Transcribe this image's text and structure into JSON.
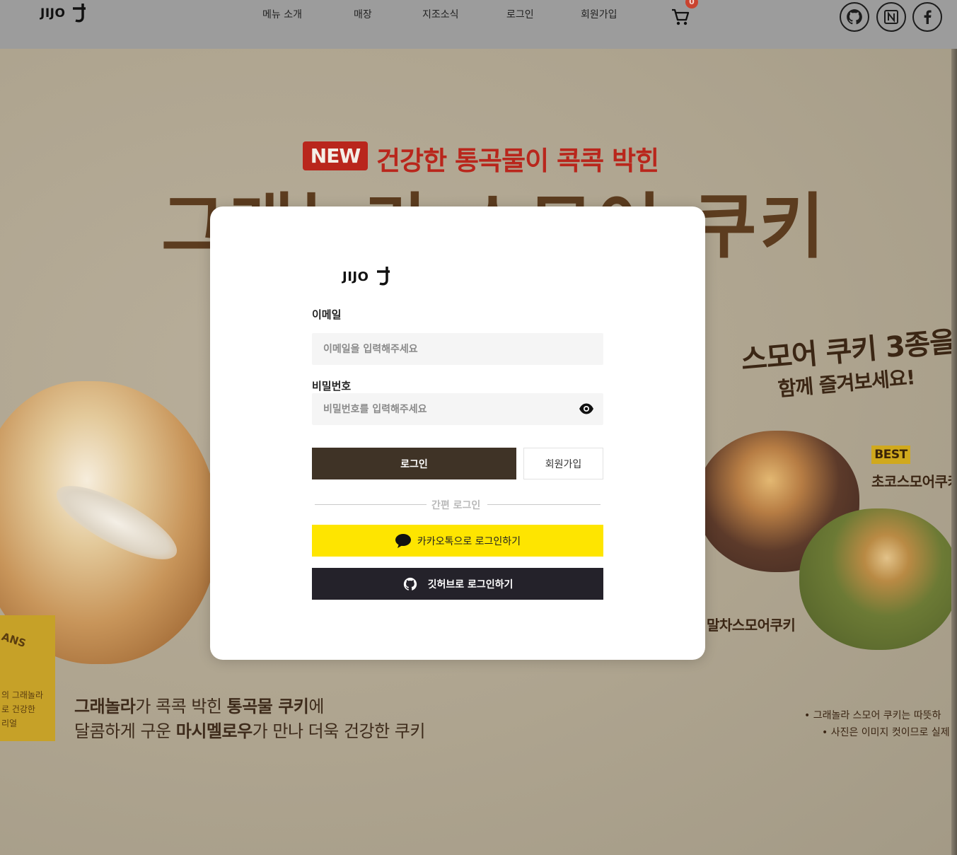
{
  "header": {
    "brand": "JIJO",
    "nav": [
      {
        "label": "메뉴 소개"
      },
      {
        "label": "매장"
      },
      {
        "label": "지조소식"
      },
      {
        "label": "로그인"
      },
      {
        "label": "회원가입"
      }
    ],
    "cart_count": "0",
    "social_icons": [
      "github-icon",
      "notion-icon",
      "facebook-icon"
    ]
  },
  "banner": {
    "new_badge": "NEW",
    "promo_line": "건강한 통곡물이 콕콕 박힌",
    "title": "그래놀라 스모어 쿠키",
    "smore_main": "스모어 쿠키 3종을",
    "smore_sub": "함께 즐겨보세요!",
    "best_tag": "BEST",
    "product_choco": "초코스모어쿠키",
    "product_matcha": "말차스모어쿠키",
    "desc_line1_a": "그래놀라",
    "desc_line1_b": "가 콕콕 박힌 ",
    "desc_line1_c": "통곡물 쿠키",
    "desc_line1_d": "에",
    "desc_line2_a": "달콤하게 구운 ",
    "desc_line2_b": "마시멜로우",
    "desc_line2_c": "가 만나 더욱 건강한 쿠키",
    "side_badge_top": "ANS",
    "side_badge_lines": [
      "의 그래놀라",
      "로 건강한",
      "리얼"
    ],
    "note1": "• 그래놀라 스모어 쿠키는 따뜻하",
    "note2": "• 사진은 이미지 컷이므로 실제"
  },
  "modal": {
    "brand": "JIJO",
    "email_label": "이메일",
    "email_placeholder": "이메일을 입력해주세요",
    "password_label": "비밀번호",
    "password_placeholder": "비밀번호를 입력해주세요",
    "login_button": "로그인",
    "signup_button": "회원가입",
    "divider_text": "간편 로그인",
    "kakao_button": "카카오톡으로 로그인하기",
    "github_button": "깃허브로 로그인하기"
  },
  "colors": {
    "header_bg": "#9c9c9c",
    "new_badge": "#b9261c",
    "login_button": "#3f3326",
    "kakao": "#fee500",
    "github": "#24222a",
    "best_tag": "#d0a91d"
  }
}
